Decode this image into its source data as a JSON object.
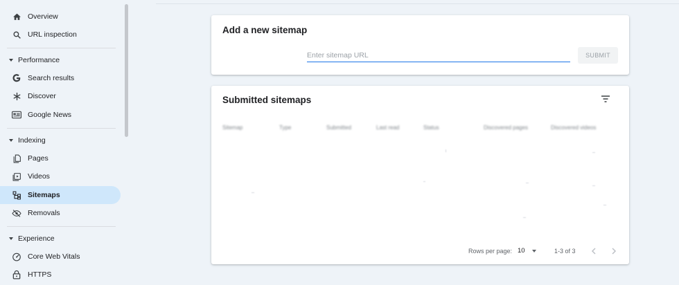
{
  "sidebar": {
    "items_top": [
      {
        "label": "Overview",
        "icon": "home-icon"
      },
      {
        "label": "URL inspection",
        "icon": "search-icon"
      }
    ],
    "performance": {
      "title": "Performance",
      "items": [
        {
          "label": "Search results",
          "icon": "google-g-icon"
        },
        {
          "label": "Discover",
          "icon": "asterisk-icon"
        },
        {
          "label": "Google News",
          "icon": "news-icon"
        }
      ]
    },
    "indexing": {
      "title": "Indexing",
      "items": [
        {
          "label": "Pages",
          "icon": "pages-icon"
        },
        {
          "label": "Videos",
          "icon": "video-icon"
        },
        {
          "label": "Sitemaps",
          "icon": "sitemap-icon",
          "active": true
        },
        {
          "label": "Removals",
          "icon": "eye-off-icon"
        }
      ]
    },
    "experience": {
      "title": "Experience",
      "items": [
        {
          "label": "Core Web Vitals",
          "icon": "gauge-icon"
        },
        {
          "label": "HTTPS",
          "icon": "lock-icon"
        }
      ]
    }
  },
  "add_sitemap": {
    "title": "Add a new sitemap",
    "placeholder": "Enter sitemap URL",
    "submit_label": "SUBMIT"
  },
  "submitted": {
    "title": "Submitted sitemaps",
    "columns": [
      "Sitemap",
      "Type",
      "Submitted",
      "Last read",
      "Status",
      "Discovered pages",
      "Discovered videos"
    ],
    "footer": {
      "rows_per_page_label": "Rows per page:",
      "rows_per_page_value": "10",
      "range": "1-3 of 3"
    }
  },
  "colors": {
    "accent": "#1a73e8",
    "active_bg": "#cfe7fb",
    "page_bg": "#eef3f8"
  }
}
